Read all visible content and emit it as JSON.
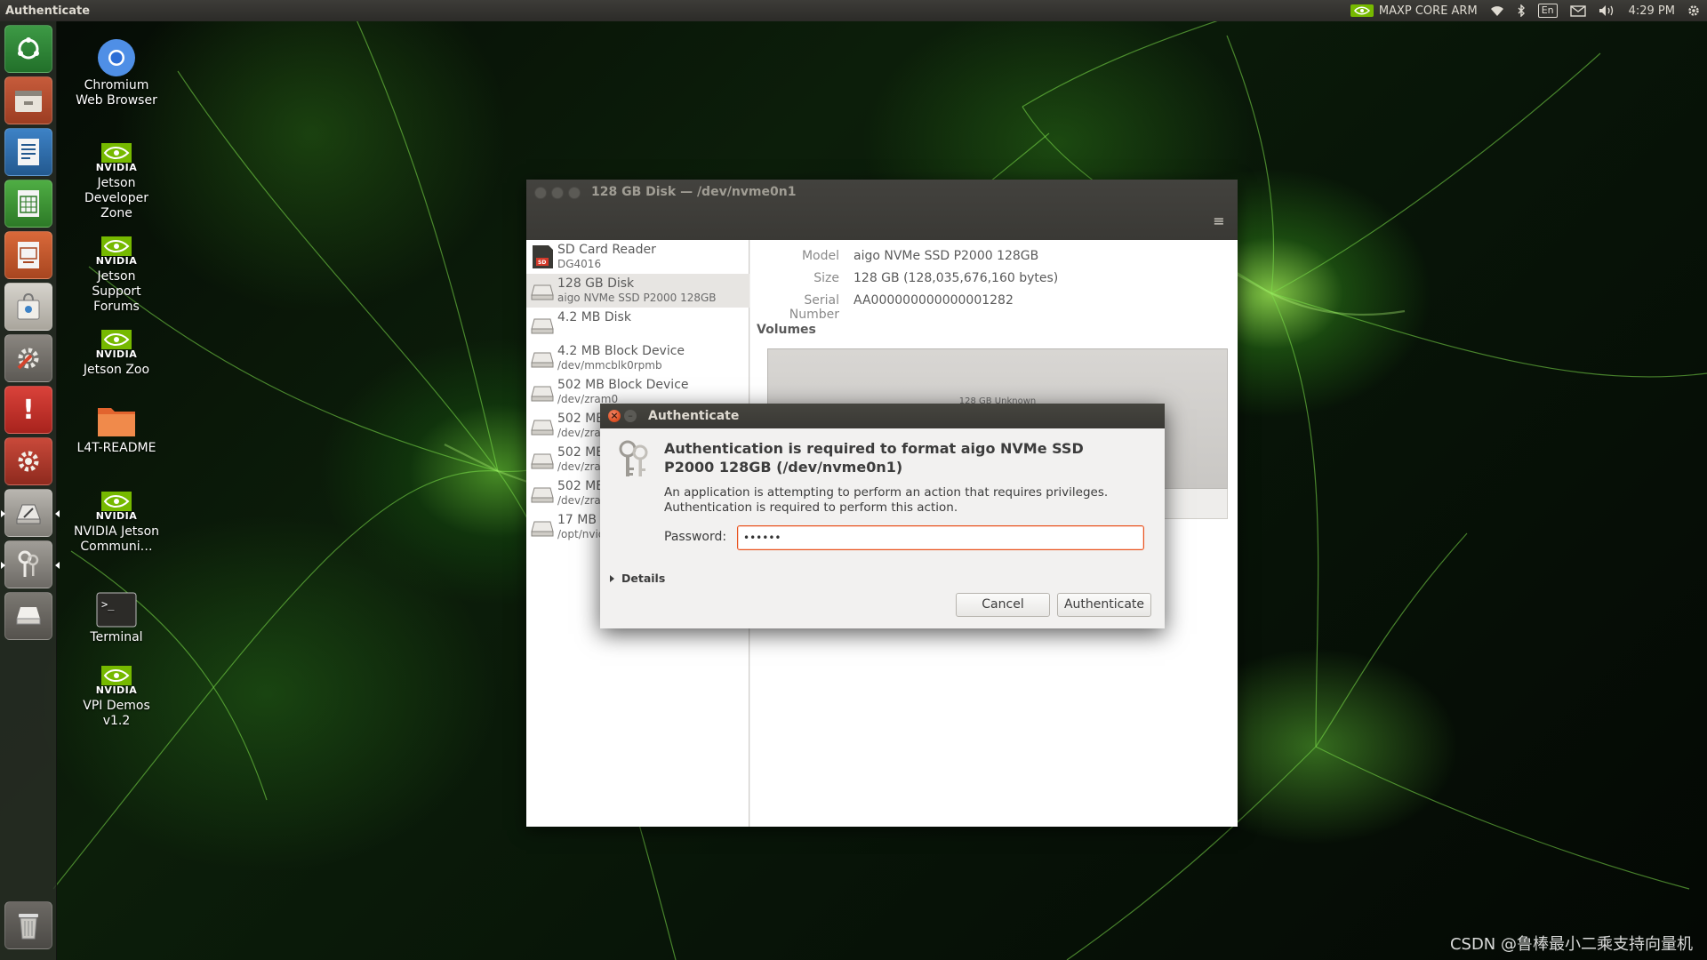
{
  "topbar": {
    "app_title": "Authenticate",
    "power_mode": "MAXP CORE ARM",
    "lang": "En",
    "time": "4:29 PM"
  },
  "launcher": {
    "items": [
      {
        "icon": "dash-home-icon"
      },
      {
        "icon": "files-icon"
      },
      {
        "icon": "writer-icon"
      },
      {
        "icon": "calc-icon"
      },
      {
        "icon": "impress-icon"
      },
      {
        "icon": "software-center-icon"
      },
      {
        "icon": "settings-icon"
      },
      {
        "icon": "error-report-icon"
      },
      {
        "icon": "software-updater-icon"
      },
      {
        "icon": "disks-utility-icon"
      },
      {
        "icon": "passwords-keys-icon"
      },
      {
        "icon": "disk-drive-icon"
      },
      {
        "icon": "trash-icon"
      }
    ]
  },
  "desktop": {
    "icons": [
      {
        "label": "Chromium Web Browser"
      },
      {
        "brand": "NVIDIA",
        "label": "Jetson Developer Zone"
      },
      {
        "brand": "NVIDIA",
        "label": "Jetson Support Forums"
      },
      {
        "brand": "NVIDIA",
        "label": "Jetson Zoo"
      },
      {
        "label": "L4T-README"
      },
      {
        "brand": "NVIDIA",
        "label": "NVIDIA Jetson Communi…"
      },
      {
        "label": "Terminal"
      },
      {
        "brand": "NVIDIA",
        "label": "VPI Demos v1.2"
      }
    ]
  },
  "disks_window": {
    "title": "128 GB Disk — /dev/nvme0n1",
    "menu_glyph": "≡",
    "devices": [
      {
        "name": "SD Card Reader",
        "sub": "DG4016"
      },
      {
        "name": "128 GB Disk",
        "sub": "aigo NVMe SSD P2000 128GB",
        "selected": true
      },
      {
        "name": "4.2 MB Disk",
        "sub": ""
      },
      {
        "name": "4.2 MB Block Device",
        "sub": "/dev/mmcblk0rpmb"
      },
      {
        "name": "502 MB Block Device",
        "sub": "/dev/zram0"
      },
      {
        "name": "502 MB Block Device",
        "sub": "/dev/zram1"
      },
      {
        "name": "502 MB Block Device",
        "sub": "/dev/zram2"
      },
      {
        "name": "502 MB Block Device",
        "sub": "/dev/zram3"
      },
      {
        "name": "17 MB Loop Device",
        "sub": "/opt/nvidia"
      }
    ],
    "properties": [
      {
        "label": "Model",
        "value": "aigo NVMe SSD P2000 128GB"
      },
      {
        "label": "Size",
        "value": "128 GB (128,035,676,160 bytes)"
      },
      {
        "label": "Serial Number",
        "value": "AA000000000000001282"
      }
    ],
    "volumes_label": "Volumes",
    "volume_bar_label": "128 GB Unknown"
  },
  "auth_dialog": {
    "title": "Authenticate",
    "close_glyph": "×",
    "min_glyph": "–",
    "heading": "Authentication is required to format aigo NVMe SSD P2000 128GB (/dev/nvme0n1)",
    "body": "An application is attempting to perform an action that requires privileges. Authentication is required to perform this action.",
    "password_label": "Password:",
    "password_value": "xxxxxx",
    "details_label": "Details",
    "cancel_label": "Cancel",
    "authenticate_label": "Authenticate"
  },
  "watermark": "CSDN @鲁棒最小二乘支持向量机",
  "colors": {
    "accent": "#e95420",
    "panel": "#3a3935",
    "nvidia_green": "#76b900"
  }
}
